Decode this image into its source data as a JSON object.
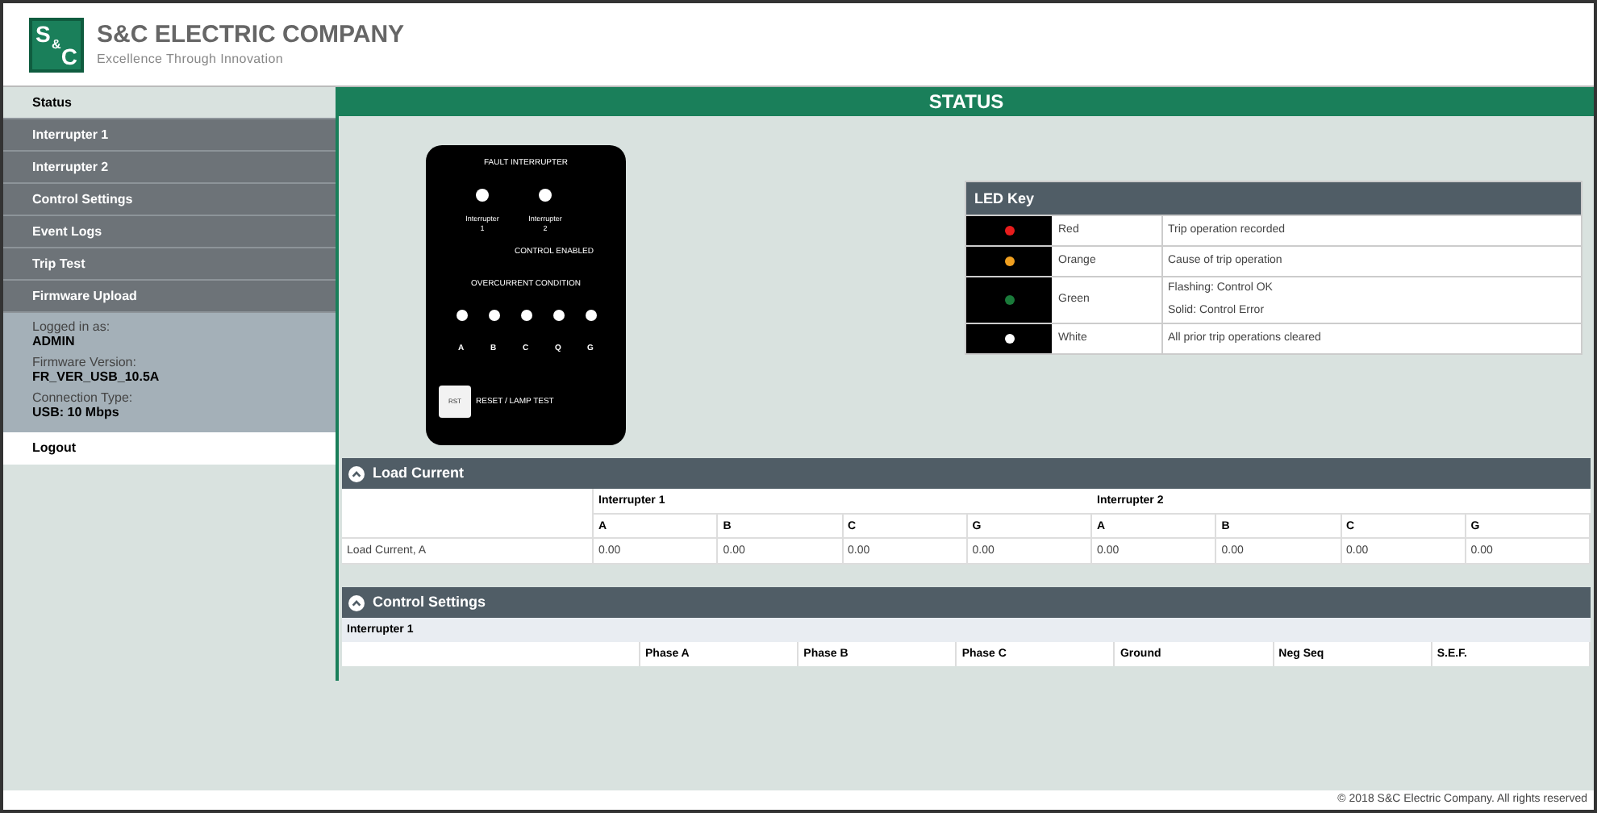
{
  "header": {
    "company": "S&C ELECTRIC COMPANY",
    "tagline": "Excellence Through Innovation",
    "logo_top": "S",
    "logo_mid": "&",
    "logo_bottom": "C"
  },
  "sidebar": {
    "items": [
      {
        "label": "Status",
        "selected": true
      },
      {
        "label": "Interrupter 1",
        "selected": false
      },
      {
        "label": "Interrupter 2",
        "selected": false
      },
      {
        "label": "Control Settings",
        "selected": false
      },
      {
        "label": "Event Logs",
        "selected": false
      },
      {
        "label": "Trip Test",
        "selected": false
      },
      {
        "label": "Firmware Upload",
        "selected": false
      }
    ],
    "info": [
      {
        "label": "Logged in as:",
        "value": "ADMIN"
      },
      {
        "label": "Firmware Version:",
        "value": "FR_VER_USB_10.5A"
      },
      {
        "label": "Connection Type:",
        "value": "USB: 10 Mbps"
      }
    ],
    "logout": "Logout"
  },
  "page_title": "STATUS",
  "led_panel": {
    "title": "FAULT INTERRUPTER",
    "interrupters": [
      {
        "line1": "Interrupter",
        "line2": "1"
      },
      {
        "line1": "Interrupter",
        "line2": "2"
      }
    ],
    "control_label": "CONTROL ENABLED",
    "overcurrent_title": "OVERCURRENT CONDITION",
    "phases": [
      "A",
      "B",
      "C",
      "Q",
      "G"
    ],
    "reset_button": "RST",
    "reset_label": "RESET / LAMP TEST"
  },
  "led_key": {
    "title": "LED Key",
    "rows": [
      {
        "color": "#e81c1c",
        "name": "Red",
        "meaning": [
          "Trip operation recorded"
        ]
      },
      {
        "color": "#f0a020",
        "name": "Orange",
        "meaning": [
          "Cause of trip operation"
        ]
      },
      {
        "color": "#1a7a3a",
        "name": "Green",
        "meaning": [
          "Flashing: Control OK",
          "Solid: Control Error"
        ]
      },
      {
        "color": "#ffffff",
        "name": "White",
        "meaning": [
          "All prior trip operations cleared"
        ]
      }
    ]
  },
  "load_current": {
    "title": "Load Current",
    "expanded": true,
    "groups": [
      "Interrupter 1",
      "Interrupter 2"
    ],
    "columns": [
      "A",
      "B",
      "C",
      "G",
      "A",
      "B",
      "C",
      "G"
    ],
    "rows": [
      {
        "label": "Load Current, A",
        "values": [
          "0.00",
          "0.00",
          "0.00",
          "0.00",
          "0.00",
          "0.00",
          "0.00",
          "0.00"
        ]
      }
    ]
  },
  "control_settings": {
    "title": "Control Settings",
    "expanded": true,
    "group": "Interrupter 1",
    "columns": [
      "Phase A",
      "Phase B",
      "Phase C",
      "Ground",
      "Neg Seq",
      "S.E.F."
    ]
  },
  "footer": "© 2018 S&C Electric Company. All rights reserved"
}
